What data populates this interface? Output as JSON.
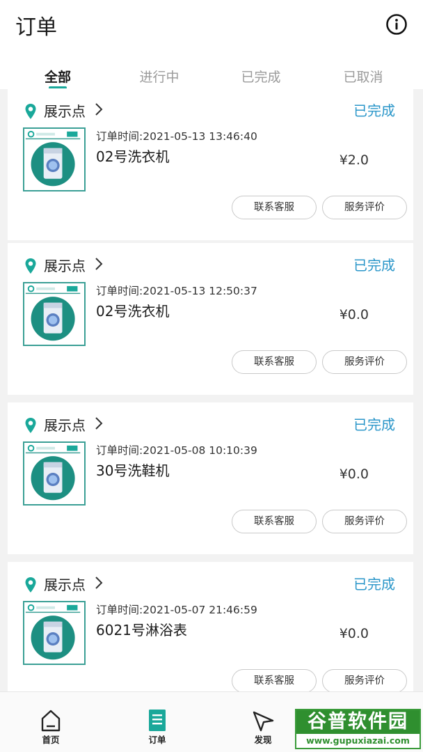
{
  "header": {
    "title": "订单"
  },
  "tabs": [
    {
      "label": "全部",
      "active": true
    },
    {
      "label": "进行中",
      "active": false
    },
    {
      "label": "已完成",
      "active": false
    },
    {
      "label": "已取消",
      "active": false
    }
  ],
  "orders": [
    {
      "store": "展示点",
      "status": "已完成",
      "time": "订单时间:2021-05-13 13:46:40",
      "machine": "02号洗衣机",
      "price": "¥2.0",
      "contact_label": "联系客服",
      "rate_label": "服务评价"
    },
    {
      "store": "展示点",
      "status": "已完成",
      "time": "订单时间:2021-05-13 12:50:37",
      "machine": "02号洗衣机",
      "price": "¥0.0",
      "contact_label": "联系客服",
      "rate_label": "服务评价"
    },
    {
      "store": "展示点",
      "status": "已完成",
      "time": "订单时间:2021-05-08 10:10:39",
      "machine": "30号洗鞋机",
      "price": "¥0.0",
      "contact_label": "联系客服",
      "rate_label": "服务评价"
    },
    {
      "store": "展示点",
      "status": "已完成",
      "time": "订单时间:2021-05-07 21:46:59",
      "machine": "6021号淋浴表",
      "price": "¥0.0",
      "contact_label": "联系客服",
      "rate_label": "服务评价"
    }
  ],
  "bottom_nav": [
    {
      "label": "首页",
      "icon": "home-icon"
    },
    {
      "label": "订单",
      "icon": "order-list-icon",
      "active": true
    },
    {
      "label": "发现",
      "icon": "discover-send-icon"
    }
  ],
  "watermark": {
    "title": "谷普软件园",
    "url": "www.gupuxiazai.com"
  },
  "colors": {
    "accent": "#1aa89a",
    "status": "#2a96c9",
    "thumb_border": "#3a9f95"
  }
}
